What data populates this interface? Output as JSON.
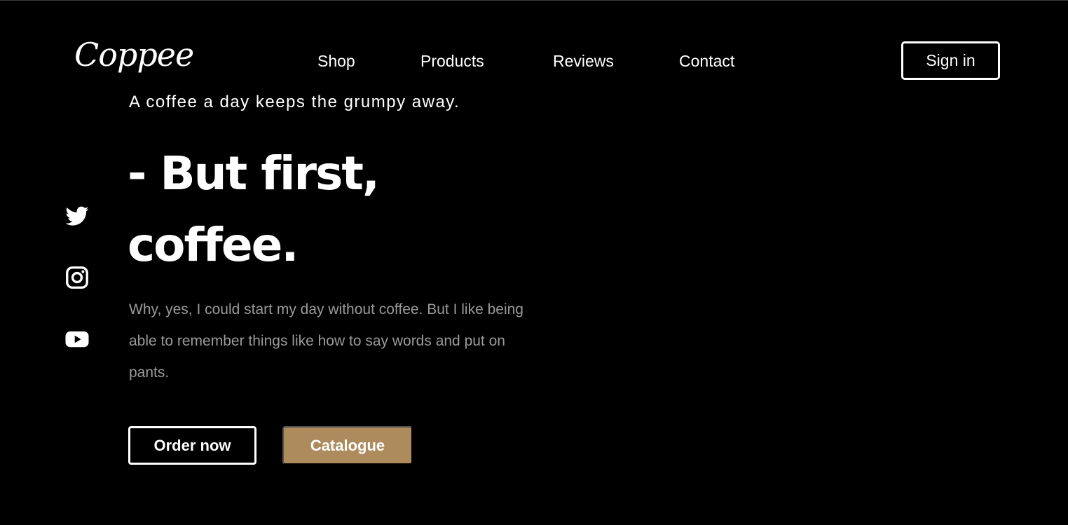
{
  "brand": {
    "logo": "Coppee"
  },
  "nav": {
    "items": [
      "Shop",
      "Products",
      "Reviews",
      "Contact"
    ]
  },
  "header": {
    "signin_label": "Sign in"
  },
  "social": {
    "icons": [
      "twitter-icon",
      "instagram-icon",
      "youtube-icon"
    ]
  },
  "hero": {
    "tagline": "A coffee a day keeps the grumpy away.",
    "headline_line1": "- But first,",
    "headline_line2": "coffee.",
    "description": "Why, yes, I could start my day without coffee. But I like being able to remember things like how to say words and put on pants.",
    "order_label": "Order now",
    "catalogue_label": "Catalogue"
  },
  "colors": {
    "background": "#000000",
    "accent": "#ad8b5c",
    "muted_text": "#9a9a9a"
  }
}
